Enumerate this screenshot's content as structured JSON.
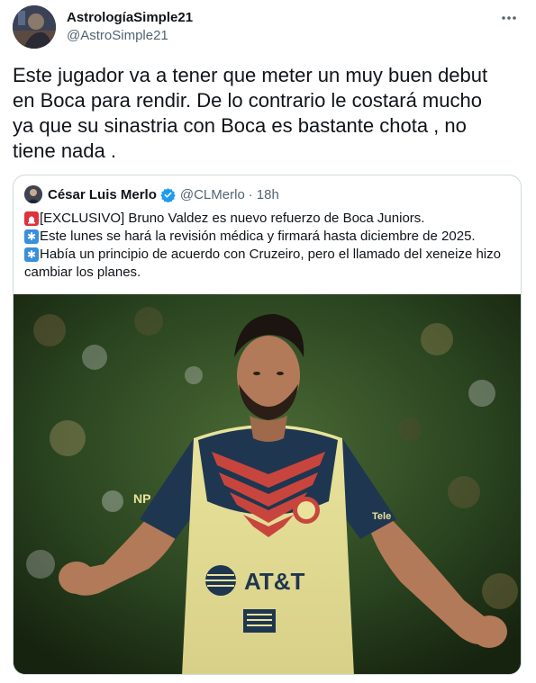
{
  "tweet": {
    "author_name": "AstrologíaSimple21",
    "author_handle": "@AstroSimple21",
    "text_lines": [
      "Este jugador va a tener que meter un muy buen debut",
      "en Boca para rendir. De lo contrario le costará mucho",
      "ya que su sinastria con Boca  es bastante chota , no",
      "tiene nada ."
    ],
    "icons": {
      "more": "more-options-icon",
      "avatar": "avatar"
    }
  },
  "quoted_tweet": {
    "author_name": "César Luis Merlo",
    "author_handle": "@CLMerlo",
    "separator": "·",
    "time": "18h",
    "lines": [
      {
        "emoji": "siren-icon",
        "text": "[EXCLUSIVO] Bruno Valdez es nuevo refuerzo de Boca Juniors."
      },
      {
        "emoji": "asterisk-icon",
        "text": "Este lunes se hará la revisión médica y firmará hasta diciembre de 2025."
      },
      {
        "emoji": "asterisk-icon",
        "text": "Había un principio de acuerdo con Cruzeiro, pero el llamado del xeneize hizo"
      },
      {
        "emoji": "",
        "text": "cambiar los planes."
      }
    ],
    "photo": {
      "jersey_sponsor": "AT&T",
      "jersey_brand_left": "NP",
      "jersey_brand_right": "Tele"
    }
  },
  "colors": {
    "text_primary": "#0f1419",
    "text_secondary": "#536471",
    "border": "#cfd9de",
    "verified_blue": "#1d9bf0",
    "emoji_red": "#e0323c",
    "emoji_blue": "#3a8fd9"
  }
}
